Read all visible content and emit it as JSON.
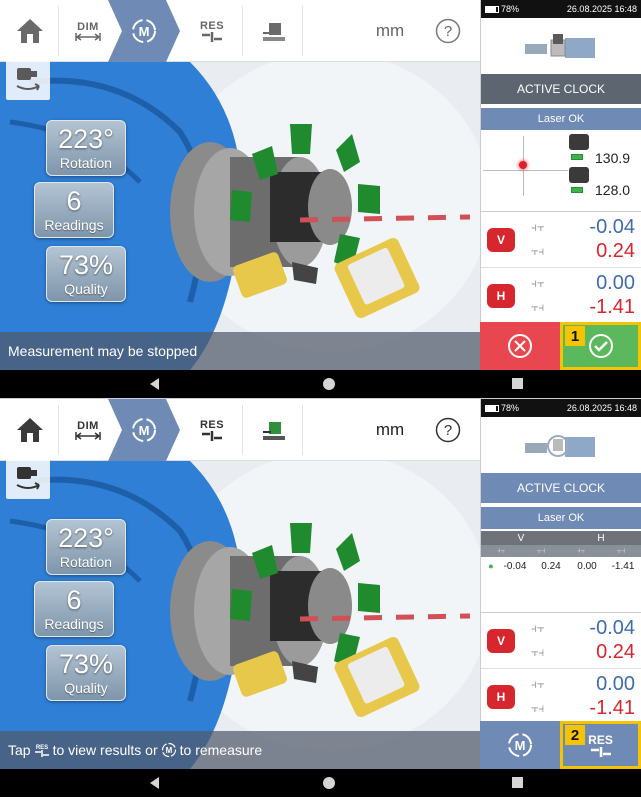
{
  "toolbar": {
    "dim_label": "DIM",
    "res_label": "RES",
    "units": "mm",
    "help": "?"
  },
  "icons": [
    "home-icon",
    "dim-icon",
    "measure-icon",
    "res-icon",
    "machine-icon",
    "help-icon",
    "camera-rotate-icon",
    "check-icon",
    "close-icon",
    "back-icon"
  ],
  "colors": {
    "accent": "#6f8ab5",
    "red": "#d8262e",
    "green": "#5cb85c",
    "highlight": "#f5c400",
    "blue_value": "#3f6cb0"
  },
  "system": {
    "battery": "78%",
    "datetime": "26.08.2025  16:48"
  },
  "panel": {
    "active_clock": "ACTIVE CLOCK",
    "laser_status": "Laser OK"
  },
  "screen1": {
    "overlay": {
      "rotation_value": "223°",
      "rotation_label": "Rotation",
      "readings_value": "6",
      "readings_label": "Readings",
      "quality_value": "73%",
      "quality_label": "Quality"
    },
    "sensor1": "130.9",
    "sensor2": "128.0",
    "vertical": {
      "badge": "V",
      "offset": "-0.04",
      "angularity": "0.24"
    },
    "horizontal": {
      "badge": "H",
      "offset": "0.00",
      "angularity": "-1.41"
    },
    "status": "Measurement may be stopped",
    "step": "1"
  },
  "screen2": {
    "overlay": {
      "rotation_value": "223°",
      "rotation_label": "Rotation",
      "readings_value": "6",
      "readings_label": "Readings",
      "quality_value": "73%",
      "quality_label": "Quality"
    },
    "table": {
      "col_v": "V",
      "col_h": "H",
      "row": [
        "-0.04",
        "0.24",
        "0.00",
        "-1.41"
      ]
    },
    "vertical": {
      "badge": "V",
      "offset": "-0.04",
      "angularity": "0.24"
    },
    "horizontal": {
      "badge": "H",
      "offset": "0.00",
      "angularity": "-1.41"
    },
    "status_pre": "Tap",
    "status_mid": "to view results or",
    "status_post": "to remeasure",
    "res_label": "RES",
    "step": "2"
  }
}
